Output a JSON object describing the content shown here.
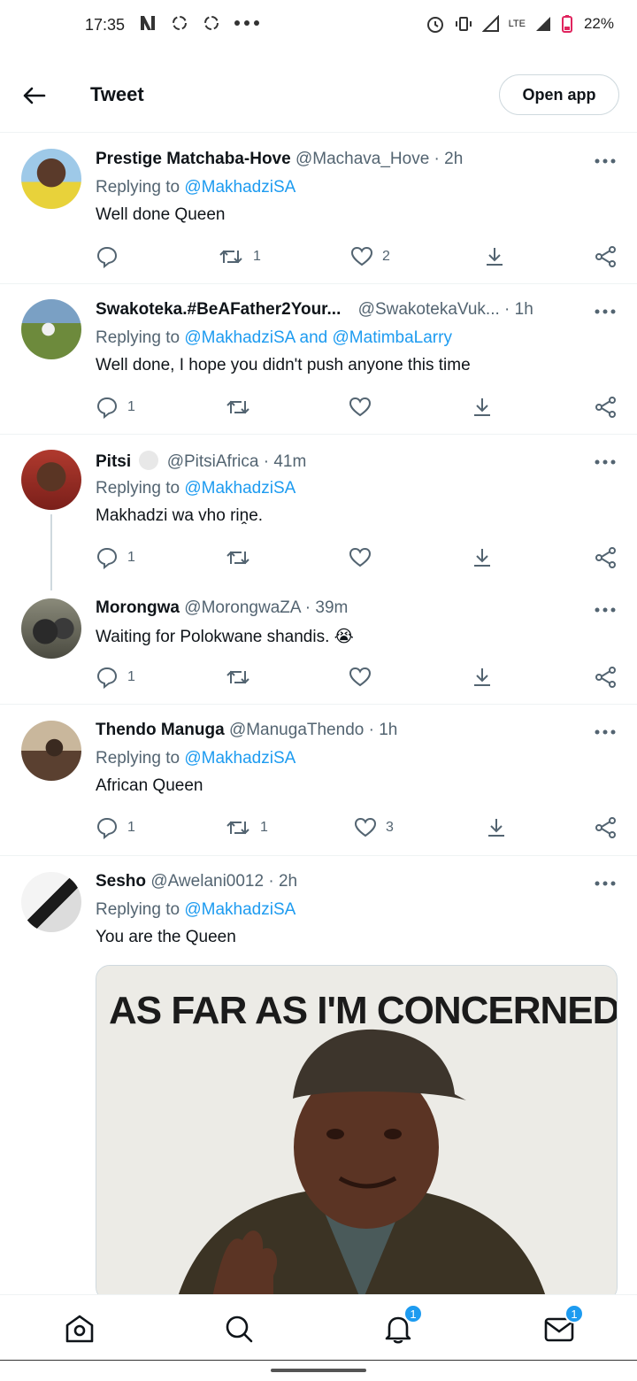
{
  "status_bar": {
    "time": "17:35",
    "battery": "22%",
    "network": "LTE"
  },
  "header": {
    "title": "Tweet",
    "open_app_label": "Open app"
  },
  "tweets": [
    {
      "name": "Prestige Matchaba-Hove",
      "handle": "@Machava_Hove",
      "time": "2h",
      "replying_prefix": "Replying to ",
      "replying_to": "@MakhadziSA",
      "replying_and": "",
      "replying_to2": "",
      "text": "Well done Queen",
      "replies": "",
      "retweets": "1",
      "likes": "2"
    },
    {
      "name": "Swakoteka.#BeAFather2Your...",
      "handle": "@SwakotekaVuk...",
      "time": "1h",
      "replying_prefix": "Replying to ",
      "replying_to": "@MakhadziSA",
      "replying_and": " and ",
      "replying_to2": "@MatimbaLarry",
      "text": "Well done, I hope you didn't push anyone this time",
      "replies": "1",
      "retweets": "",
      "likes": ""
    },
    {
      "name": "Pitsi",
      "handle": "@PitsiAfrica",
      "time": "41m",
      "replying_prefix": "Replying to ",
      "replying_to": "@MakhadziSA",
      "replying_and": "",
      "replying_to2": "",
      "text": "Makhadzi wa vho riṋe.",
      "replies": "1",
      "retweets": "",
      "likes": ""
    },
    {
      "name": "Morongwa",
      "handle": "@MorongwaZA",
      "time": "39m",
      "replying_prefix": "",
      "replying_to": "",
      "replying_and": "",
      "replying_to2": "",
      "text": "Waiting for Polokwane shandis. 😭",
      "replies": "1",
      "retweets": "",
      "likes": ""
    },
    {
      "name": "Thendo Manuga",
      "handle": "@ManugaThendo",
      "time": "1h",
      "replying_prefix": "Replying to ",
      "replying_to": "@MakhadziSA",
      "replying_and": "",
      "replying_to2": "",
      "text": "African Queen",
      "replies": "1",
      "retweets": "1",
      "likes": "3"
    },
    {
      "name": "Sesho",
      "handle": "@Awelani0012",
      "time": "2h",
      "replying_prefix": "Replying to ",
      "replying_to": "@MakhadziSA",
      "replying_and": "",
      "replying_to2": "",
      "text": "You are the Queen",
      "replies": "",
      "retweets": "",
      "likes": "",
      "media_caption": "AS FAR AS I'M CONCERNED"
    }
  ],
  "bottom_nav": {
    "notifications_badge": "1",
    "messages_badge": "1"
  },
  "colors": {
    "accent": "#1d9bf0",
    "secondary_text": "#536471",
    "divider": "#eff3f4"
  }
}
